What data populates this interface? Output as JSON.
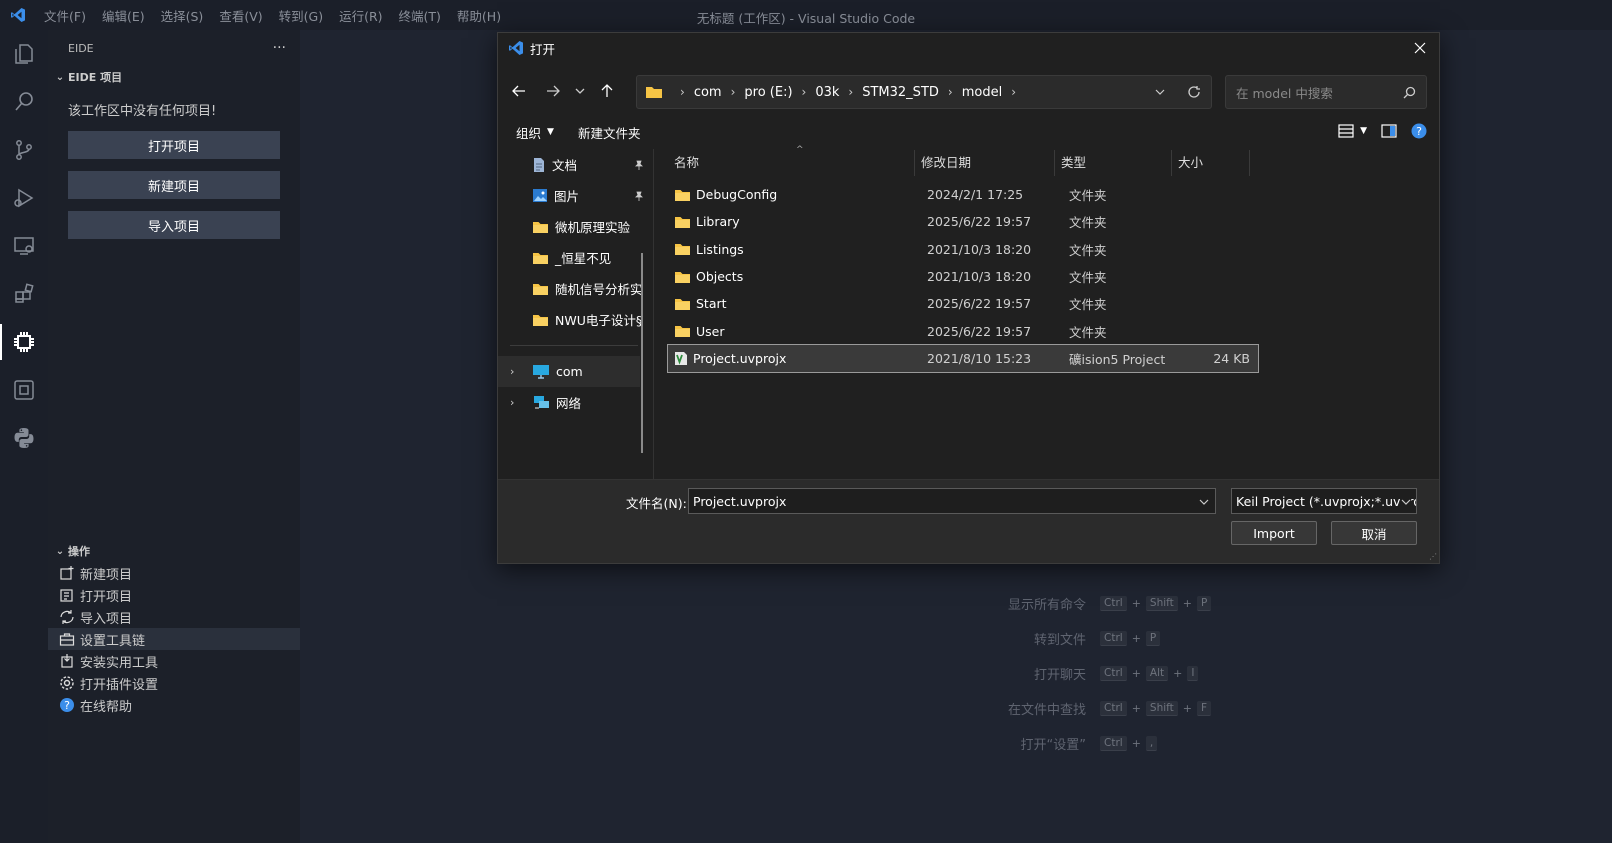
{
  "window": {
    "title": "无标题 (工作区) - Visual Studio Code",
    "menu": [
      "文件(F)",
      "编辑(E)",
      "选择(S)",
      "查看(V)",
      "转到(G)",
      "运行(R)",
      "终端(T)",
      "帮助(H)"
    ]
  },
  "sidebar": {
    "header": "EIDE",
    "more": "···",
    "project_section": "EIDE 项目",
    "empty_message": "该工作区中没有任何项目!",
    "buttons": [
      "打开项目",
      "新建项目",
      "导入项目"
    ],
    "ops_section": "操作",
    "ops": [
      "新建项目",
      "打开项目",
      "导入项目",
      "设置工具链",
      "安装实用工具",
      "打开插件设置",
      "在线帮助"
    ]
  },
  "shortcuts": [
    {
      "label": "显示所有命令",
      "keys": [
        "Ctrl",
        "Shift",
        "P"
      ]
    },
    {
      "label": "转到文件",
      "keys": [
        "Ctrl",
        "P"
      ]
    },
    {
      "label": "打开聊天",
      "keys": [
        "Ctrl",
        "Alt",
        "I"
      ]
    },
    {
      "label": "在文件中查找",
      "keys": [
        "Ctrl",
        "Shift",
        "F"
      ]
    },
    {
      "label": "打开“设置”",
      "keys": [
        "Ctrl",
        ","
      ]
    }
  ],
  "dialog": {
    "title": "打开",
    "breadcrumb": [
      "com",
      "pro (E:)",
      "03k",
      "STM32_STD",
      "model"
    ],
    "search_placeholder": "在 model 中搜索",
    "toolbar": {
      "organize": "组织",
      "new_folder": "新建文件夹"
    },
    "nav": {
      "quick": [
        {
          "name": "文档",
          "pinned": true,
          "icon": "document-icon"
        },
        {
          "name": "图片",
          "pinned": true,
          "icon": "picture-icon"
        },
        {
          "name": "微机原理实验",
          "pinned": false,
          "icon": "folder-icon"
        },
        {
          "name": "_恒星不见",
          "pinned": false,
          "icon": "folder-icon"
        },
        {
          "name": "随机信号分析实",
          "pinned": false,
          "icon": "folder-icon"
        },
        {
          "name": "NWU电子设计§",
          "pinned": false,
          "icon": "folder-icon"
        }
      ],
      "locations": [
        {
          "name": "com",
          "icon": "computer-icon"
        },
        {
          "name": "网络",
          "icon": "network-icon"
        }
      ]
    },
    "columns": [
      "名称",
      "修改日期",
      "类型",
      "大小"
    ],
    "files": [
      {
        "name": "DebugConfig",
        "date": "2024/2/1 17:25",
        "type": "文件夹",
        "size": "",
        "icon": "folder-icon"
      },
      {
        "name": "Library",
        "date": "2025/6/22 19:57",
        "type": "文件夹",
        "size": "",
        "icon": "folder-icon"
      },
      {
        "name": "Listings",
        "date": "2021/10/3 18:20",
        "type": "文件夹",
        "size": "",
        "icon": "folder-icon"
      },
      {
        "name": "Objects",
        "date": "2021/10/3 18:20",
        "type": "文件夹",
        "size": "",
        "icon": "folder-icon"
      },
      {
        "name": "Start",
        "date": "2025/6/22 19:57",
        "type": "文件夹",
        "size": "",
        "icon": "folder-icon"
      },
      {
        "name": "User",
        "date": "2025/6/22 19:57",
        "type": "文件夹",
        "size": "",
        "icon": "folder-icon"
      },
      {
        "name": "Project.uvprojx",
        "date": "2021/8/10 15:23",
        "type": "礦ision5 Project",
        "size": "24 KB",
        "icon": "keil-project-icon",
        "selected": true
      }
    ],
    "filename_label": "文件名(N):",
    "filename_value": "Project.uvprojx",
    "filter_value": "Keil Project (*.uvprojx;*.uvproj)",
    "import_label": "Import",
    "cancel_label": "取消"
  },
  "colors": {
    "folder": "#f6c445",
    "accent": "#3b8eea",
    "background": "#1f2430"
  }
}
